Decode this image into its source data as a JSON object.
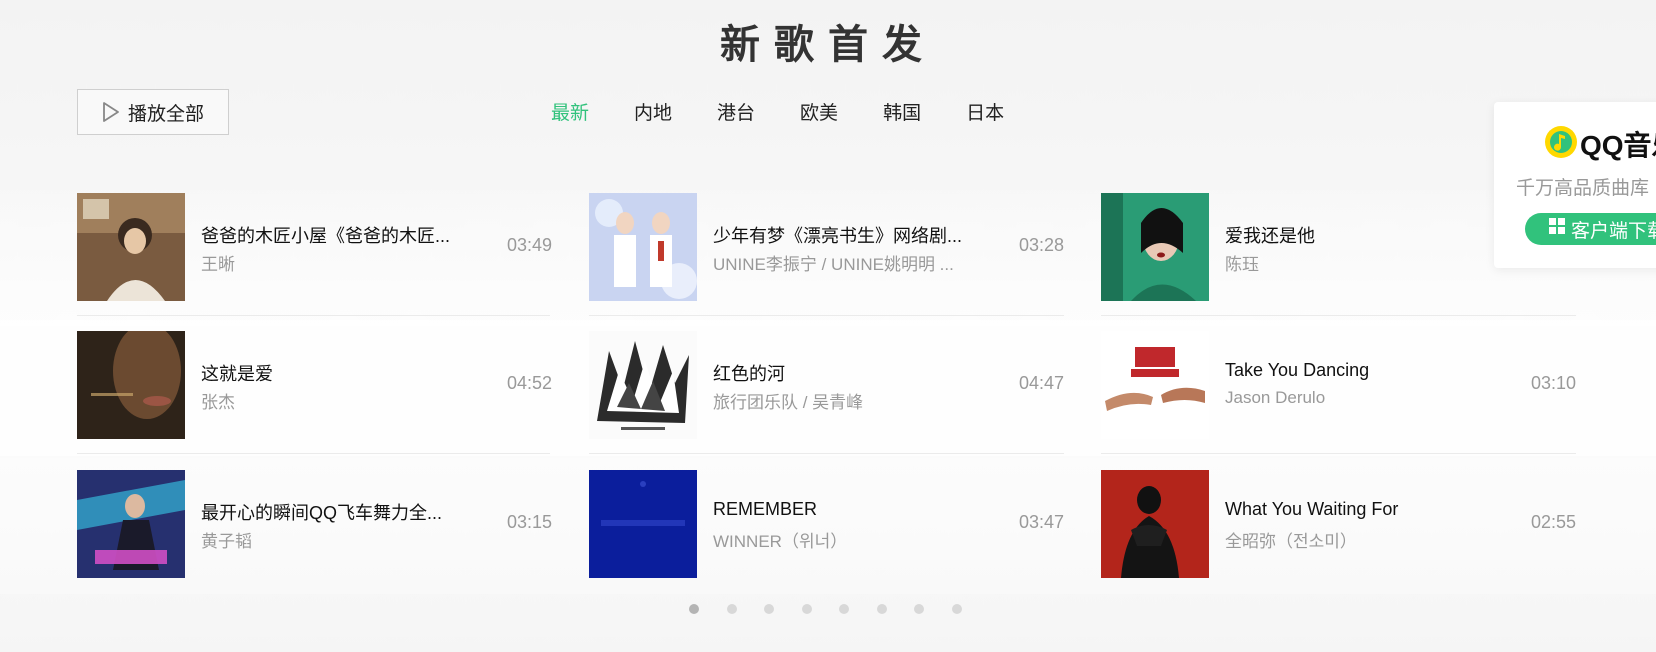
{
  "section_title": "新歌首发",
  "play_all": {
    "label": "播放全部"
  },
  "tabs": [
    {
      "label": "最新",
      "active": true
    },
    {
      "label": "内地",
      "active": false
    },
    {
      "label": "港台",
      "active": false
    },
    {
      "label": "欧美",
      "active": false
    },
    {
      "label": "韩国",
      "active": false
    },
    {
      "label": "日本",
      "active": false
    }
  ],
  "songs": [
    {
      "title": "爸爸的木匠小屋《爸爸的木匠...",
      "artist": "王晰",
      "duration": "03:49",
      "cover_color": "#8a6a4a"
    },
    {
      "title": "少年有梦《漂亮书生》网络剧...",
      "artist": "UNINE李振宁 / UNINE姚明明 ...",
      "duration": "03:28",
      "cover_color": "#b9c6ea"
    },
    {
      "title": "爱我还是他",
      "artist": "陈珏",
      "duration": "",
      "cover_color": "#1f8a67"
    },
    {
      "title": "这就是爱",
      "artist": "张杰",
      "duration": "04:52",
      "cover_color": "#2c2118"
    },
    {
      "title": "红色的河",
      "artist": "旅行团乐队 / 吴青峰",
      "duration": "04:47",
      "cover_color": "#ffffff"
    },
    {
      "title": "Take You Dancing",
      "artist": "Jason Derulo",
      "duration": "03:10",
      "cover_color": "#ffffff"
    },
    {
      "title": "最开心的瞬间QQ飞车舞力全...",
      "artist": "黄子韬",
      "duration": "03:15",
      "cover_color": "#2a3a8a"
    },
    {
      "title": "REMEMBER",
      "artist": "WINNER（위너）",
      "duration": "03:47",
      "cover_color": "#0a1f9c"
    },
    {
      "title": "What You Waiting For",
      "artist": "全昭弥（전소미）",
      "duration": "02:55",
      "cover_color": "#b3251b"
    }
  ],
  "pagination": {
    "pages": 8,
    "current": 1
  },
  "promo": {
    "brand": "QQ音乐",
    "slogan": "千万高品质曲库",
    "button_label": "客户端下载",
    "accent": "#31c27c"
  }
}
